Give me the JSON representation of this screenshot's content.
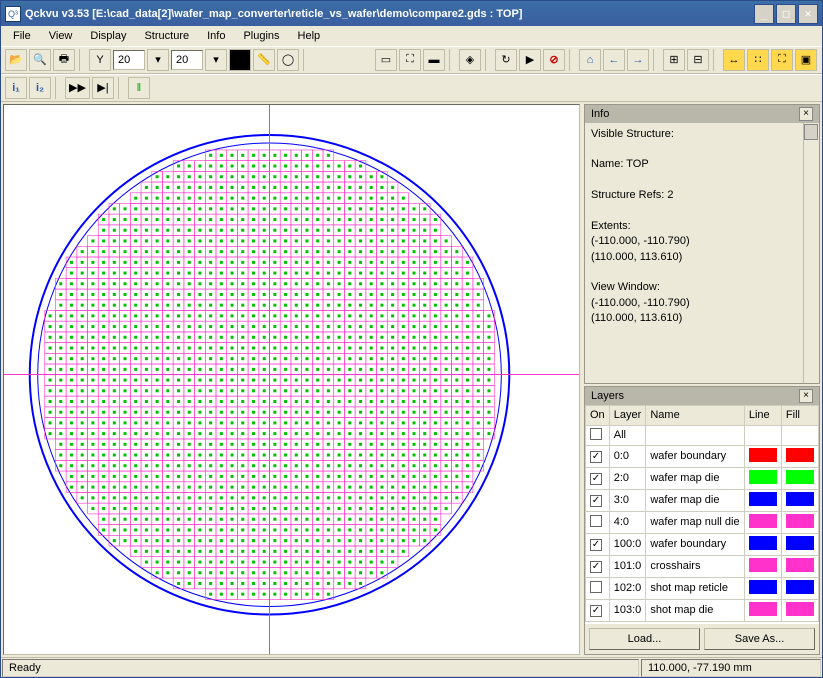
{
  "title": "Qckvu v3.53 [E:\\cad_data[2]\\wafer_map_converter\\reticle_vs_wafer\\demo\\compare2.gds : TOP]",
  "menu": [
    "File",
    "View",
    "Display",
    "Structure",
    "Info",
    "Plugins",
    "Help"
  ],
  "toolbar_numbers": {
    "a": "20",
    "b": "20"
  },
  "info_panel": {
    "title": "Info",
    "visible_structure_label": "Visible Structure:",
    "name_label": "Name: ",
    "name_value": "TOP",
    "refs_label": "Structure Refs: ",
    "refs_value": "2",
    "extents_label": "Extents:",
    "extents_l1": "(-110.000, -110.790)",
    "extents_l2": "(110.000, 113.610)",
    "view_label": "View Window:",
    "view_l1": "(-110.000, -110.790)",
    "view_l2": "(110.000, 113.610)"
  },
  "layers_panel": {
    "title": "Layers",
    "headers": [
      "On",
      "Layer",
      "Name",
      "Line",
      "Fill"
    ],
    "rows": [
      {
        "on": false,
        "layer": "All",
        "name": "",
        "line": "",
        "fill": ""
      },
      {
        "on": true,
        "layer": "0:0",
        "name": "wafer boundary",
        "line": "#ff0000",
        "fill": "#ff0000"
      },
      {
        "on": true,
        "layer": "2:0",
        "name": "wafer map die",
        "line": "#00ff00",
        "fill": "#00ff00"
      },
      {
        "on": true,
        "layer": "3:0",
        "name": "wafer map die",
        "line": "#0000ff",
        "fill": "#0000ff"
      },
      {
        "on": false,
        "layer": "4:0",
        "name": "wafer map null die",
        "line": "#ff33cc",
        "fill": "#ff33cc"
      },
      {
        "on": true,
        "layer": "100:0",
        "name": "wafer boundary",
        "line": "#0000ff",
        "fill": "#0000ff"
      },
      {
        "on": true,
        "layer": "101:0",
        "name": "crosshairs",
        "line": "#ff33cc",
        "fill": "#ff33cc"
      },
      {
        "on": false,
        "layer": "102:0",
        "name": "shot map reticle",
        "line": "#0000ff",
        "fill": "#0000ff"
      },
      {
        "on": true,
        "layer": "103:0",
        "name": "shot map die",
        "line": "#ff33cc",
        "fill": "#ff33cc"
      }
    ],
    "load": "Load...",
    "save": "Save As..."
  },
  "status": {
    "left": "Ready",
    "right": "110.000, -77.190 mm"
  },
  "icons": {
    "app": "Q³",
    "min": "_",
    "max": "□",
    "close": "✕",
    "open": "📂",
    "zoom": "🔍",
    "print": "🖶",
    "filter": "Y",
    "grid-a": "▦",
    "grid-b": "▨",
    "ruler": "📏",
    "circle": "◯",
    "rect-out": "▭",
    "rect-dot": "⛶",
    "rect-fill": "▬",
    "stack": "◈",
    "refresh": "↻",
    "play": "▶",
    "stop": "⊘",
    "home": "⌂",
    "left": "←",
    "right": "→",
    "plus-box": "⊞",
    "minus-box": "⊟",
    "arrows-h": "↔",
    "dots": "∷",
    "full": "⛶",
    "fit": "▣",
    "i1": "i₁",
    "i2": "i₂",
    "ff": "▶▶",
    "ffe": "▶|",
    "bar": "‖"
  },
  "chart_data": {
    "type": "wafer-map",
    "wafer_radius": 110.0,
    "units": "mm",
    "crosshair": {
      "x": 0,
      "y": 0
    },
    "grid": {
      "nx": 42,
      "ny": 42,
      "pitch_x": 5.0,
      "pitch_y": 5.0
    },
    "extents": {
      "xmin": -110.0,
      "ymin": -110.79,
      "xmax": 110.0,
      "ymax": 113.61
    }
  }
}
